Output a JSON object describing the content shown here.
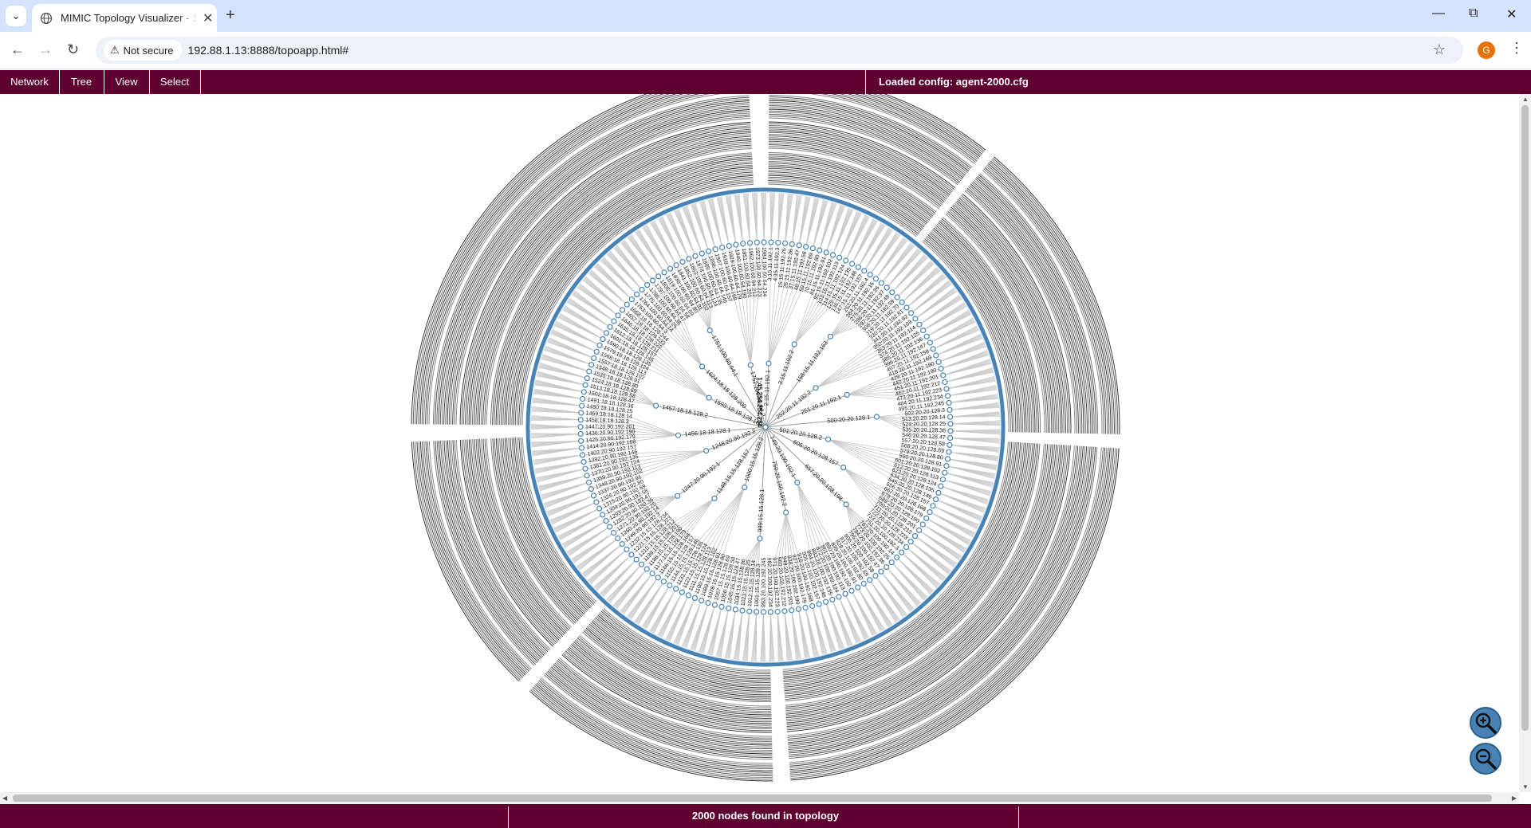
{
  "browser": {
    "tab_title": "MIMIC Topology Visualizer - 192.88.1.13",
    "security_label": "Not secure",
    "url": "192.88.1.13:8888/topoapp.html#",
    "profile_initial": "G"
  },
  "app": {
    "menu": [
      "Network",
      "Tree",
      "View",
      "Select"
    ],
    "loaded_config": "Loaded config: agent-2000.cfg",
    "status_message": "2000 nodes found in topology"
  },
  "topology": {
    "root_label": "1:45.254.254.254",
    "hub_labels": [
      "2:15.11.192.1",
      "3:15.11.192.2",
      "158:15.11.192.163",
      "252:20.11.192.2",
      "251:20.11.192.1",
      "500:20.20.128.1",
      "501:20.20.128.2",
      "606:20.20.128.157",
      "657:20.20.128.198",
      "749:20.100.192.1",
      "750:20.100.192.2",
      "999:15.15.128.1",
      "1000:15.15.128.2",
      "1148:15.15.128.157",
      "1247:20.90.192.1",
      "1248:20.90.192.2",
      "1456:18.18.128.1",
      "1457:18.18.128.2",
      "1593:18.18.128.169",
      "1624:18.18.128.200",
      "1751:100.60.64.1",
      "1752:100.60.64.2"
    ],
    "leaf_labels_right": [
      "3:15.11.192.1",
      "4:15.11.192.3",
      "15:15.11.192.25",
      "26:15.11.192.36",
      "37:15.11.192.47",
      "48:15.11.192.58",
      "59:15.11.192.69",
      "70:15.11.192.80",
      "81:15.11.192.91",
      "92:15.11.192.102",
      "103:15.11.192.113",
      "114:15.11.192.124",
      "125:15.11.192.135",
      "136:15.11.192.146",
      "147:15.11.192.157",
      "253:20.11.192.4",
      "264:20.11.192.15",
      "275:20.11.192.26",
      "286:20.11.192.37",
      "297:20.11.192.48",
      "308:20.11.192.59",
      "319:20.11.192.70",
      "330:20.11.192.81",
      "341:20.11.192.92",
      "352:20.11.192.103",
      "363:20.11.192.114",
      "374:20.11.192.125",
      "385:20.11.192.136",
      "396:20.11.192.147",
      "407:20.11.192.158",
      "418:20.11.192.169",
      "429:20.11.192.180",
      "440:20.11.192.190",
      "451:20.11.192.201",
      "462:20.11.192.212",
      "473:20.11.192.223",
      "484:20.11.192.234",
      "495:20.11.192.245",
      "502:20.20.128.3",
      "513:20.20.128.14",
      "524:20.20.128.25",
      "535:20.20.128.36",
      "546:20.20.128.47",
      "557:20.20.128.58",
      "568:20.20.128.69",
      "579:20.20.128.80",
      "590:20.20.128.91",
      "601:20.20.128.102",
      "612:20.20.128.113",
      "623:20.20.128.124",
      "634:20.20.128.135",
      "645:20.20.128.146",
      "656:20.20.128.157",
      "667:20.20.128.168",
      "678:20.20.128.179",
      "689:20.20.128.190",
      "700:20.20.128.201",
      "711:20.20.128.212",
      "722:20.20.128.223",
      "733:20.20.128.234",
      "751:20.100.192.3",
      "762:20.100.192.14",
      "773:20.100.192.25",
      "784:20.100.192.36",
      "795:20.100.192.47",
      "806:20.100.192.58",
      "817:20.100.192.69",
      "828:20.100.192.80",
      "839:20.100.192.91",
      "850:20.100.192.102",
      "861:20.100.192.113",
      "872:20.100.192.124",
      "883:20.100.192.135",
      "894:20.100.192.146",
      "905:20.100.192.157",
      "916:20.100.192.168",
      "927:20.100.192.179",
      "938:20.100.192.190",
      "949:20.100.192.201",
      "960:20.100.192.212",
      "971:20.100.192.223",
      "982:20.100.192.234",
      "993:20.100.192.245"
    ],
    "leaf_labels_left": [
      "1001:15.15.128.3",
      "1012:15.15.128.14",
      "1023:15.15.128.25",
      "1034:15.15.128.36",
      "1045:15.15.128.47",
      "1056:15.15.128.58",
      "1067:15.15.128.69",
      "1078:15.15.128.80",
      "1089:15.15.128.91",
      "1100:15.15.128.102",
      "1111:15.15.128.113",
      "1122:15.15.128.124",
      "1133:15.15.128.135",
      "1144:15.15.128.146",
      "1155:15.15.128.157",
      "1166:15.15.128.168",
      "1177:15.15.128.179",
      "1188:15.15.128.190",
      "1199:15.15.128.201",
      "1210:15.15.128.212",
      "1221:15.15.128.223",
      "1232:15.15.128.234",
      "1249:20.90.192.3",
      "1260:20.90.192.14",
      "1271:20.90.192.25",
      "1282:20.90.192.36",
      "1293:20.90.192.47",
      "1304:20.90.192.58",
      "1315:20.90.192.69",
      "1326:20.90.192.80",
      "1337:20.90.192.91",
      "1348:20.90.192.102",
      "1359:20.90.192.113",
      "1370:20.90.192.124",
      "1381:20.90.192.135",
      "1392:20.90.192.146",
      "1403:20.90.192.157",
      "1414:20.90.192.168",
      "1425:20.90.192.179",
      "1436:20.90.192.190",
      "1447:20.90.192.201",
      "1458:18.18.128.3",
      "1469:18.18.128.14",
      "1480:18.18.128.25",
      "1491:18.18.128.36",
      "1502:18.18.128.47",
      "1513:18.18.128.58",
      "1524:18.18.128.69",
      "1535:18.18.128.80",
      "1546:18.18.128.91",
      "1557:18.18.128.102",
      "1568:18.18.128.113",
      "1579:18.18.128.124",
      "1590:18.18.128.135",
      "1601:18.18.128.146",
      "1612:18.18.128.157",
      "1635:18.18.128.211",
      "1646:18.18.128.222",
      "1657:18.18.128.233",
      "1668:18.18.128.244",
      "1753:100.60.64.3",
      "1764:100.60.64.14",
      "1775:100.60.64.25",
      "1786:100.60.64.36",
      "1797:100.60.64.47",
      "1808:100.60.64.58",
      "1819:100.60.64.69",
      "1830:100.60.64.80",
      "1841:100.60.64.91",
      "1852:100.60.64.102",
      "1863:100.60.64.113",
      "1874:100.60.64.124",
      "1885:100.60.64.135",
      "1896:100.60.64.146",
      "1907:100.60.64.157",
      "1918:100.60.64.168",
      "1929:100.60.64.179",
      "1940:100.60.64.190",
      "1951:100.60.64.201",
      "1962:100.60.64.212",
      "1973:100.60.64.223",
      "1984:100.60.64.234"
    ],
    "colors": {
      "link": "#c8c8c8",
      "node_stroke": "#4682b4",
      "label": "#222222",
      "bar": "#5e0030"
    }
  }
}
